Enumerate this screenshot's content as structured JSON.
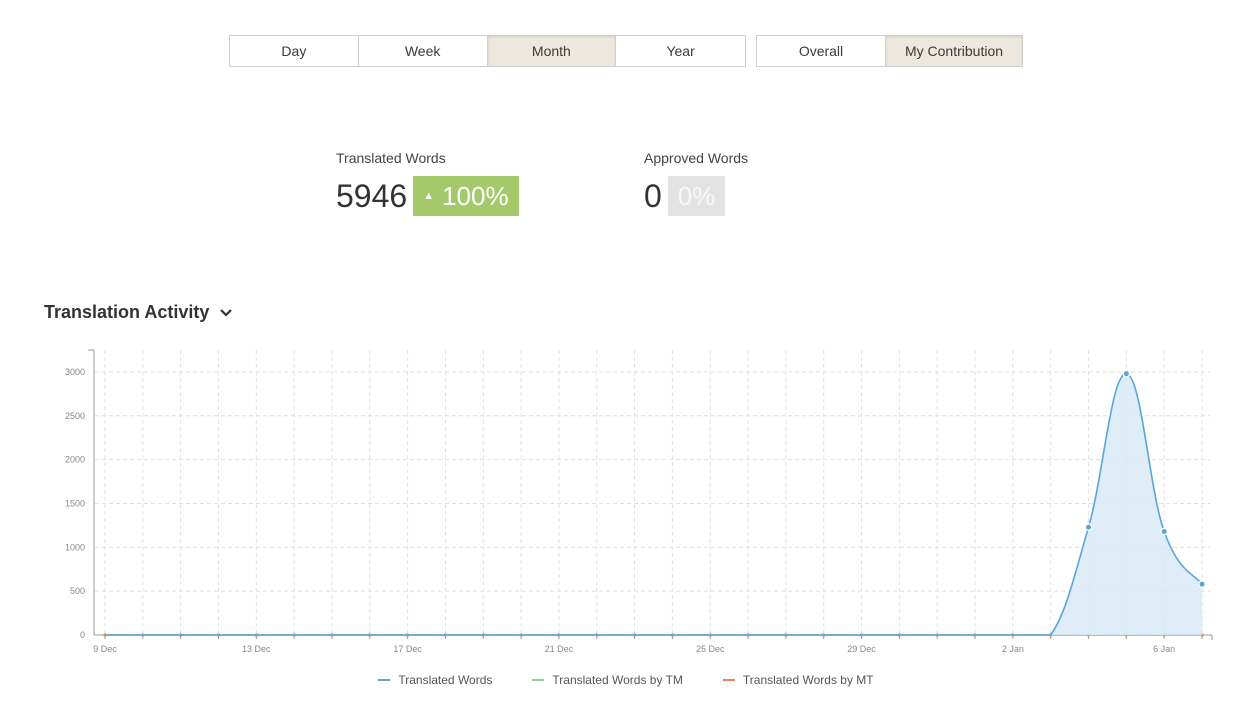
{
  "range_tabs": [
    {
      "label": "Day",
      "active": false
    },
    {
      "label": "Week",
      "active": false
    },
    {
      "label": "Month",
      "active": true
    },
    {
      "label": "Year",
      "active": false
    }
  ],
  "scope_tabs": [
    {
      "label": "Overall",
      "active": false
    },
    {
      "label": "My Contribution",
      "active": true
    }
  ],
  "stats": {
    "translated": {
      "label": "Translated Words",
      "value": "5946",
      "change": "100%"
    },
    "approved": {
      "label": "Approved Words",
      "value": "0",
      "change": "0%"
    }
  },
  "section": {
    "title": "Translation Activity"
  },
  "colors": {
    "translated": "#5aa5d8",
    "tm": "#8fd19e",
    "mt": "#ef7d5b",
    "badge_up": "#a3c96a",
    "area_fill": "#d8eaf7"
  },
  "chart_data": {
    "type": "area",
    "x": [
      "9 Dec",
      "10 Dec",
      "11 Dec",
      "12 Dec",
      "13 Dec",
      "14 Dec",
      "15 Dec",
      "16 Dec",
      "17 Dec",
      "18 Dec",
      "19 Dec",
      "20 Dec",
      "21 Dec",
      "22 Dec",
      "23 Dec",
      "24 Dec",
      "25 Dec",
      "26 Dec",
      "27 Dec",
      "28 Dec",
      "29 Dec",
      "30 Dec",
      "31 Dec",
      "1 Jan",
      "2 Jan",
      "3 Jan",
      "4 Jan",
      "5 Jan",
      "6 Jan",
      "7 Jan"
    ],
    "tick_labels": [
      "9 Dec",
      "13 Dec",
      "17 Dec",
      "21 Dec",
      "25 Dec",
      "29 Dec",
      "2 Jan",
      "6 Jan"
    ],
    "ylim": [
      0,
      3250
    ],
    "yticks": [
      0,
      500,
      1000,
      1500,
      2000,
      2500,
      3000
    ],
    "grid": true,
    "legend_position": "bottom",
    "series": [
      {
        "name": "Translated Words",
        "values": [
          0,
          0,
          0,
          0,
          0,
          0,
          0,
          0,
          0,
          0,
          0,
          0,
          0,
          0,
          0,
          0,
          0,
          0,
          0,
          0,
          0,
          0,
          0,
          0,
          0,
          0,
          1230,
          2980,
          1180,
          580
        ]
      },
      {
        "name": "Translated Words by TM",
        "values": [
          0,
          0,
          0,
          0,
          0,
          0,
          0,
          0,
          0,
          0,
          0,
          0,
          0,
          0,
          0,
          0,
          0,
          0,
          0,
          0,
          0,
          0,
          0,
          0,
          0,
          0,
          0,
          0,
          0,
          0
        ]
      },
      {
        "name": "Translated Words by MT",
        "values": [
          0,
          0,
          0,
          0,
          0,
          0,
          0,
          0,
          0,
          0,
          0,
          0,
          0,
          0,
          0,
          0,
          0,
          0,
          0,
          0,
          0,
          0,
          0,
          0,
          0,
          0,
          0,
          0,
          0,
          0
        ]
      }
    ]
  }
}
